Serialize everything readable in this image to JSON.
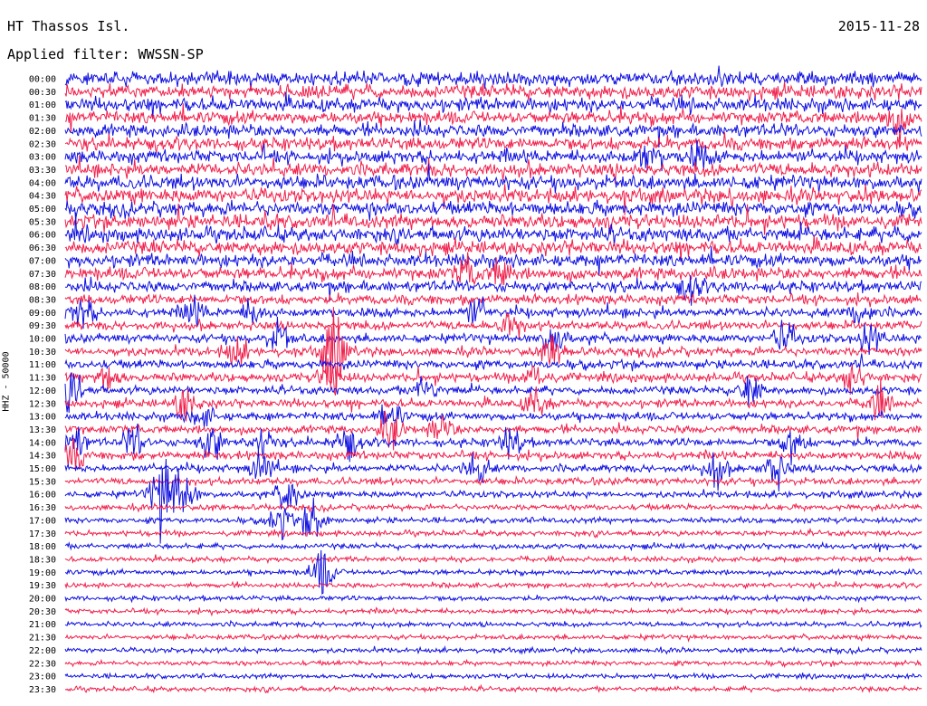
{
  "header": {
    "station": "HT Thassos Isl.",
    "date": "2015-11-28",
    "filter": "Applied filter: WWSSN-SP",
    "ylabel": "HHZ - 50000"
  },
  "colors": {
    "trace_a": "#1010e0",
    "trace_b": "#f0204c"
  },
  "chart_data": {
    "type": "line",
    "title": "HT Thassos Isl.",
    "subtitle": "Applied filter: WWSSN-SP",
    "date": "2015-11-28",
    "ylabel": "HHZ - 50000",
    "xlabel": "",
    "row_labels": [
      "00:00",
      "00:30",
      "01:00",
      "01:30",
      "02:00",
      "02:30",
      "03:00",
      "03:30",
      "04:00",
      "04:30",
      "05:00",
      "05:30",
      "06:00",
      "06:30",
      "07:00",
      "07:30",
      "08:00",
      "08:30",
      "09:00",
      "09:30",
      "10:00",
      "10:30",
      "11:00",
      "11:30",
      "12:00",
      "12:30",
      "13:00",
      "13:30",
      "14:00",
      "14:30",
      "15:00",
      "15:30",
      "16:00",
      "16:30",
      "17:00",
      "17:30",
      "18:00",
      "18:30",
      "19:00",
      "19:30",
      "20:00",
      "20:30",
      "21:00",
      "21:30",
      "22:00",
      "22:30",
      "23:00",
      "23:30"
    ],
    "row_colors": [
      "trace_a",
      "trace_b"
    ],
    "noise_level": [
      0.95,
      0.95,
      0.95,
      0.9,
      0.9,
      0.9,
      0.9,
      0.95,
      1,
      1,
      1,
      1,
      1,
      0.95,
      0.9,
      0.85,
      0.75,
      0.65,
      0.6,
      0.55,
      0.55,
      0.55,
      0.55,
      0.55,
      0.5,
      0.5,
      0.5,
      0.5,
      0.5,
      0.5,
      0.45,
      0.4,
      0.35,
      0.3,
      0.28,
      0.26,
      0.25,
      0.24,
      0.24,
      0.23,
      0.22,
      0.22,
      0.22,
      0.21,
      0.21,
      0.2,
      0.2,
      0.2
    ],
    "events": [
      {
        "row": 3,
        "x": 0.97,
        "amp": 1.4
      },
      {
        "row": 15,
        "x": 0.47,
        "amp": 1.2
      },
      {
        "row": 15,
        "x": 0.51,
        "amp": 1.1
      },
      {
        "row": 16,
        "x": 0.73,
        "amp": 1.1
      },
      {
        "row": 18,
        "x": 0.02,
        "amp": 1.3
      },
      {
        "row": 18,
        "x": 0.15,
        "amp": 1.1
      },
      {
        "row": 18,
        "x": 0.22,
        "amp": 1.0
      },
      {
        "row": 18,
        "x": 0.48,
        "amp": 1.1
      },
      {
        "row": 18,
        "x": 0.93,
        "amp": 1.3
      },
      {
        "row": 19,
        "x": 0.52,
        "amp": 1.1
      },
      {
        "row": 20,
        "x": 0.25,
        "amp": 1.4
      },
      {
        "row": 20,
        "x": 0.57,
        "amp": 1.6
      },
      {
        "row": 20,
        "x": 0.84,
        "amp": 1.2
      },
      {
        "row": 20,
        "x": 0.94,
        "amp": 1.2
      },
      {
        "row": 21,
        "x": 0.2,
        "amp": 1.2
      },
      {
        "row": 21,
        "x": 0.31,
        "amp": 1.6
      },
      {
        "row": 21,
        "x": 0.32,
        "amp": 1.8
      },
      {
        "row": 21,
        "x": 0.57,
        "amp": 1.3
      },
      {
        "row": 23,
        "x": 0.05,
        "amp": 1.3
      },
      {
        "row": 23,
        "x": 0.31,
        "amp": 1.6
      },
      {
        "row": 23,
        "x": 0.55,
        "amp": 1.2
      },
      {
        "row": 23,
        "x": 0.92,
        "amp": 1.3
      },
      {
        "row": 24,
        "x": 0.01,
        "amp": 1.6
      },
      {
        "row": 24,
        "x": 0.42,
        "amp": 1.1
      },
      {
        "row": 24,
        "x": 0.8,
        "amp": 1.5
      },
      {
        "row": 25,
        "x": 0.14,
        "amp": 1.2
      },
      {
        "row": 25,
        "x": 0.55,
        "amp": 1.2
      },
      {
        "row": 25,
        "x": 0.95,
        "amp": 1.3
      },
      {
        "row": 26,
        "x": 0.38,
        "amp": 1.3
      },
      {
        "row": 26,
        "x": 0.16,
        "amp": 1.0
      },
      {
        "row": 27,
        "x": 0.38,
        "amp": 1.4
      },
      {
        "row": 27,
        "x": 0.44,
        "amp": 1.3
      },
      {
        "row": 28,
        "x": 0.01,
        "amp": 1.6
      },
      {
        "row": 28,
        "x": 0.08,
        "amp": 1.4
      },
      {
        "row": 28,
        "x": 0.17,
        "amp": 1.6
      },
      {
        "row": 28,
        "x": 0.23,
        "amp": 1.4
      },
      {
        "row": 28,
        "x": 0.33,
        "amp": 1.5
      },
      {
        "row": 28,
        "x": 0.52,
        "amp": 1.3
      },
      {
        "row": 28,
        "x": 0.85,
        "amp": 1.4
      },
      {
        "row": 29,
        "x": 0.01,
        "amp": 1.2
      },
      {
        "row": 30,
        "x": 0.23,
        "amp": 1.3
      },
      {
        "row": 30,
        "x": 0.48,
        "amp": 1.6
      },
      {
        "row": 30,
        "x": 0.76,
        "amp": 1.5
      },
      {
        "row": 30,
        "x": 0.83,
        "amp": 1.6
      },
      {
        "row": 32,
        "x": 0.11,
        "amp": 2.0
      },
      {
        "row": 32,
        "x": 0.12,
        "amp": 2.0
      },
      {
        "row": 32,
        "x": 0.14,
        "amp": 1.8
      },
      {
        "row": 32,
        "x": 0.26,
        "amp": 1.4
      },
      {
        "row": 34,
        "x": 0.25,
        "amp": 1.5
      },
      {
        "row": 34,
        "x": 0.29,
        "amp": 1.9
      },
      {
        "row": 38,
        "x": 0.3,
        "amp": 2.0
      },
      {
        "row": 6,
        "x": 0.68,
        "amp": 0.9
      },
      {
        "row": 6,
        "x": 0.74,
        "amp": 0.9
      }
    ]
  }
}
